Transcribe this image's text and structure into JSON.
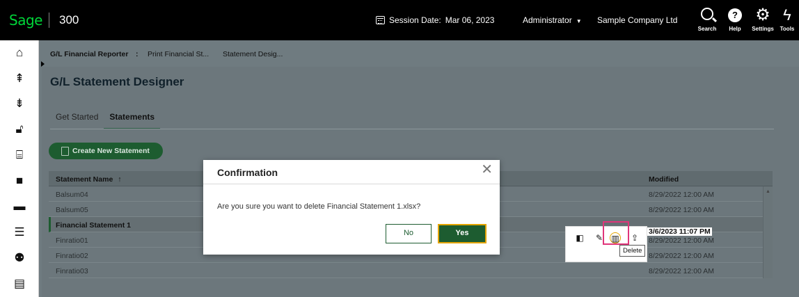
{
  "header": {
    "logo": "Sage",
    "product": "300",
    "session_label": "Session Date:",
    "session_date": "Mar 06, 2023",
    "user": "Administrator",
    "company": "Sample Company Ltd",
    "buttons": [
      {
        "label": "Search",
        "icon": "search-icon"
      },
      {
        "label": "Help",
        "icon": "help-icon"
      },
      {
        "label": "Settings",
        "icon": "gear-icon"
      },
      {
        "label": "Tools",
        "icon": "bolt-icon"
      }
    ]
  },
  "sidebar": {
    "icons": [
      "home-icon",
      "sort-up-icon",
      "sort-down-icon",
      "lock-icon",
      "bank-icon",
      "briefcase-icon",
      "folder-icon",
      "server-icon",
      "users-icon",
      "document-icon"
    ]
  },
  "breadcrumb": [
    "G/L Financial Reporter",
    ":",
    "Print Financial St...",
    "Statement Desig..."
  ],
  "page": {
    "title": "G/L Statement Designer",
    "tabs": [
      {
        "label": "Get Started",
        "active": false
      },
      {
        "label": "Statements",
        "active": true
      }
    ],
    "create_button": "Create New Statement"
  },
  "table": {
    "columns": {
      "name": "Statement Name",
      "sort": "↑",
      "modified": "Modified"
    },
    "rows": [
      {
        "name": "Balsum04",
        "modified": "8/29/2022 12:00 AM"
      },
      {
        "name": "Balsum05",
        "modified": "8/29/2022 12:00 AM"
      },
      {
        "name": "Financial Statement 1",
        "modified": "3/6/2023 11:07 PM",
        "selected": true
      },
      {
        "name": "Finratio01",
        "modified": "8/29/2022 12:00 AM"
      },
      {
        "name": "Finratio02",
        "modified": "8/29/2022 12:00 AM"
      },
      {
        "name": "Finratio03",
        "modified": "8/29/2022 12:00 AM"
      }
    ]
  },
  "actions": {
    "tooltip": "Delete",
    "icons": [
      "compare-icon",
      "edit-icon",
      "delete-icon",
      "upload-icon"
    ]
  },
  "modal": {
    "title": "Confirmation",
    "message": "Are you sure you want to delete Financial Statement 1.xlsx?",
    "no_label": "No",
    "yes_label": "Yes"
  },
  "colors": {
    "brand_green": "#1d5c30",
    "logo_green": "#00d639",
    "focus_yellow": "#e3a400",
    "highlight_pink": "#e0357a"
  }
}
